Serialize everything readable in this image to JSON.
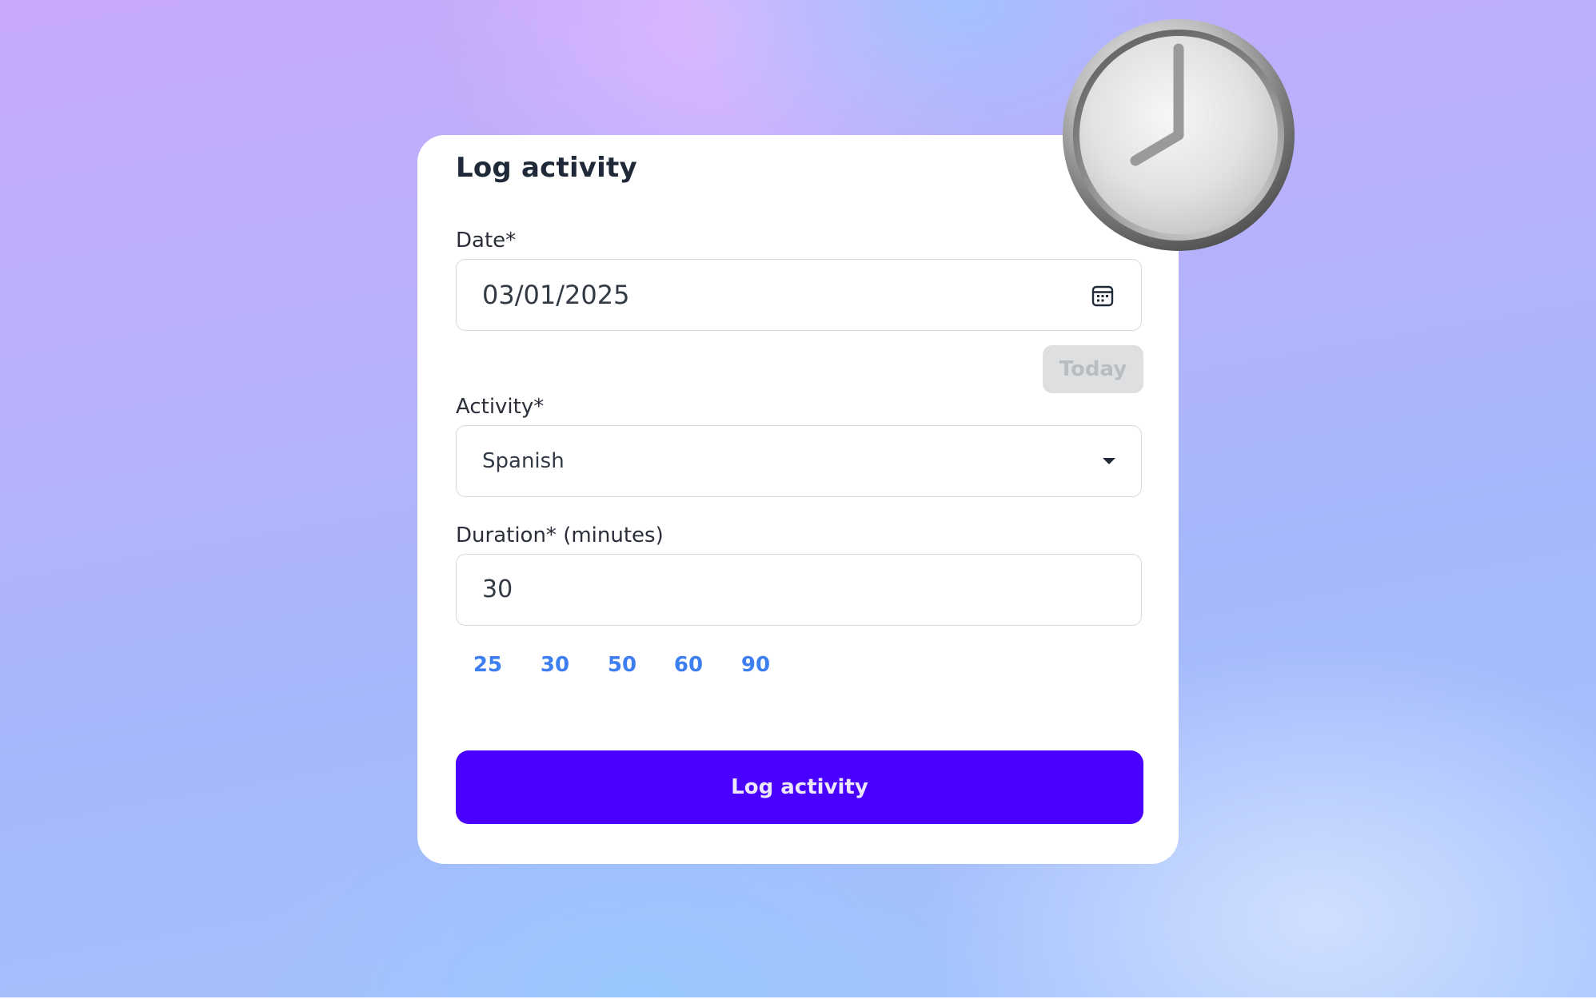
{
  "form": {
    "title": "Log activity",
    "date": {
      "label": "Date*",
      "value": "03/01/2025",
      "icon": "calendar-icon"
    },
    "today_button": "Today",
    "activity": {
      "label": "Activity*",
      "value": "Spanish",
      "icon": "chevron-down-icon"
    },
    "duration": {
      "label": "Duration* (minutes)",
      "value": "30"
    },
    "presets": [
      "25",
      "30",
      "50",
      "60",
      "90"
    ],
    "submit_label": "Log activity"
  },
  "decoration": {
    "icon": "clock-icon",
    "clock_time": "8:00"
  },
  "colors": {
    "primary": "#4a00ff",
    "preset_link": "#3d7ef0",
    "disabled_button_bg": "#dedfe1",
    "disabled_button_text": "#b9bcc1"
  }
}
